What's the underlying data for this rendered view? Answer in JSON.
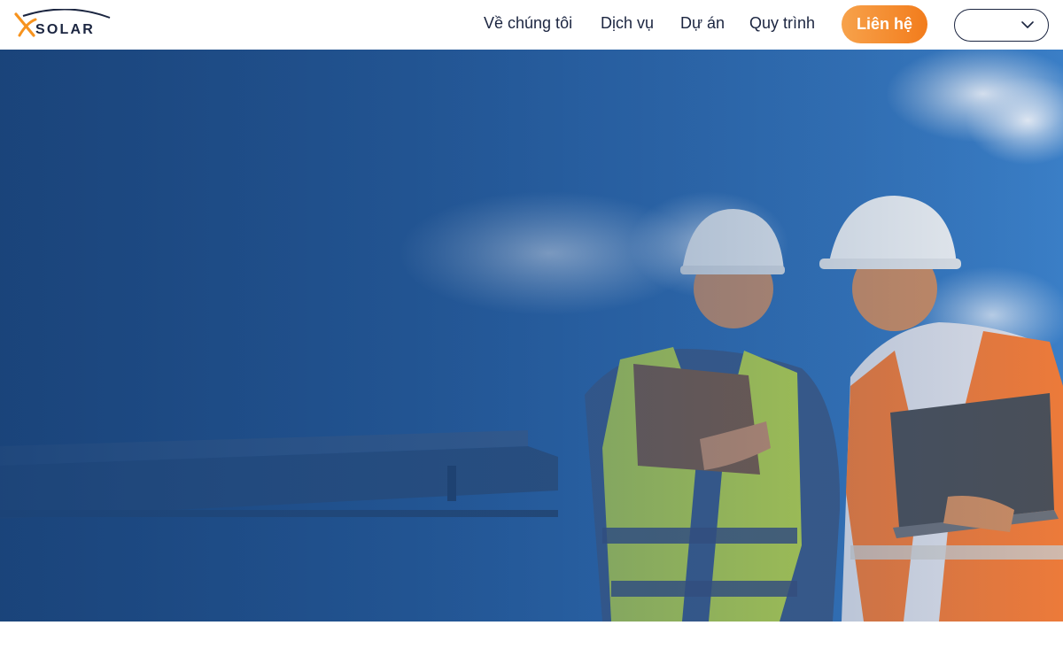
{
  "brand": {
    "name": "SOLAR",
    "accent": "#f7931e",
    "navy": "#1b2540"
  },
  "nav": {
    "items": [
      {
        "label": "Về chúng tôi"
      },
      {
        "label": "Dịch vụ"
      },
      {
        "label": "Dự án"
      },
      {
        "label": "Quy trình"
      }
    ],
    "cta_label": "Liên hệ",
    "language_value": "",
    "language_icon": "chevron-down-icon"
  },
  "hero": {
    "image": "two-engineers-hard-hats-solar-panels",
    "overlay_color": "#1f4f8c"
  }
}
